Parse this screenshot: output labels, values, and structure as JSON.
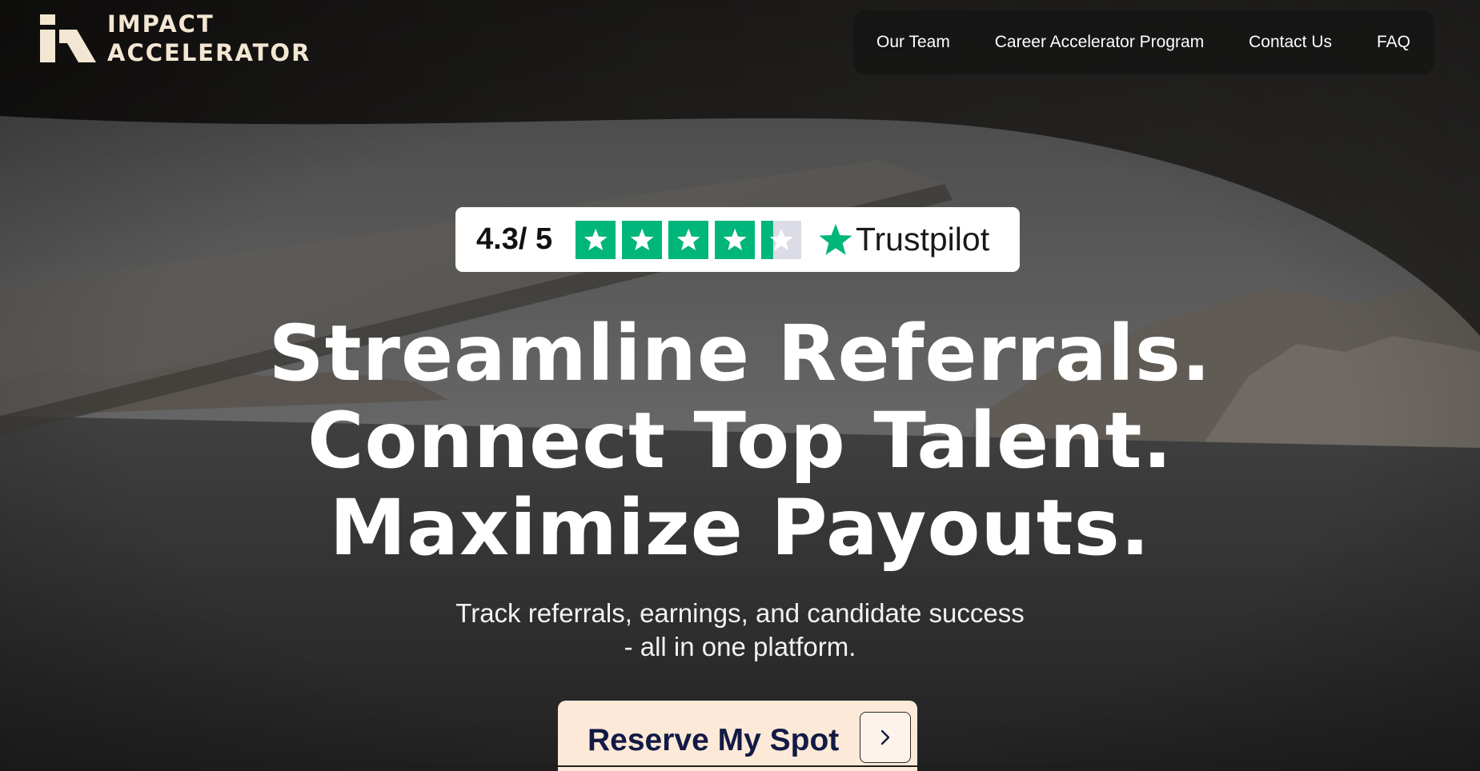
{
  "brand": {
    "line1": "IMPACT",
    "line2": "ACCELERATOR",
    "logo_icon": "ia-monogram-icon",
    "color": "#f3e6d2"
  },
  "nav": {
    "items": [
      {
        "label": "Our Team"
      },
      {
        "label": "Career Accelerator Program"
      },
      {
        "label": "Contact Us"
      },
      {
        "label": "FAQ"
      }
    ]
  },
  "rating": {
    "score_text": "4.3/ 5",
    "score": 4.3,
    "max": 5,
    "star_color": "#00b67a",
    "empty_color": "#dcdce6",
    "platform": "Trustpilot",
    "platform_icon": "trustpilot-star-icon"
  },
  "hero": {
    "headline": [
      "Streamline Referrals.",
      "Connect Top Talent.",
      "Maximize Payouts."
    ],
    "subhead": [
      "Track referrals, earnings, and candidate success",
      "- all in one platform."
    ]
  },
  "cta": {
    "label": "Reserve My Spot",
    "icon": "chevron-right-icon",
    "background": "#fde9d7",
    "text_color": "#121a45"
  }
}
